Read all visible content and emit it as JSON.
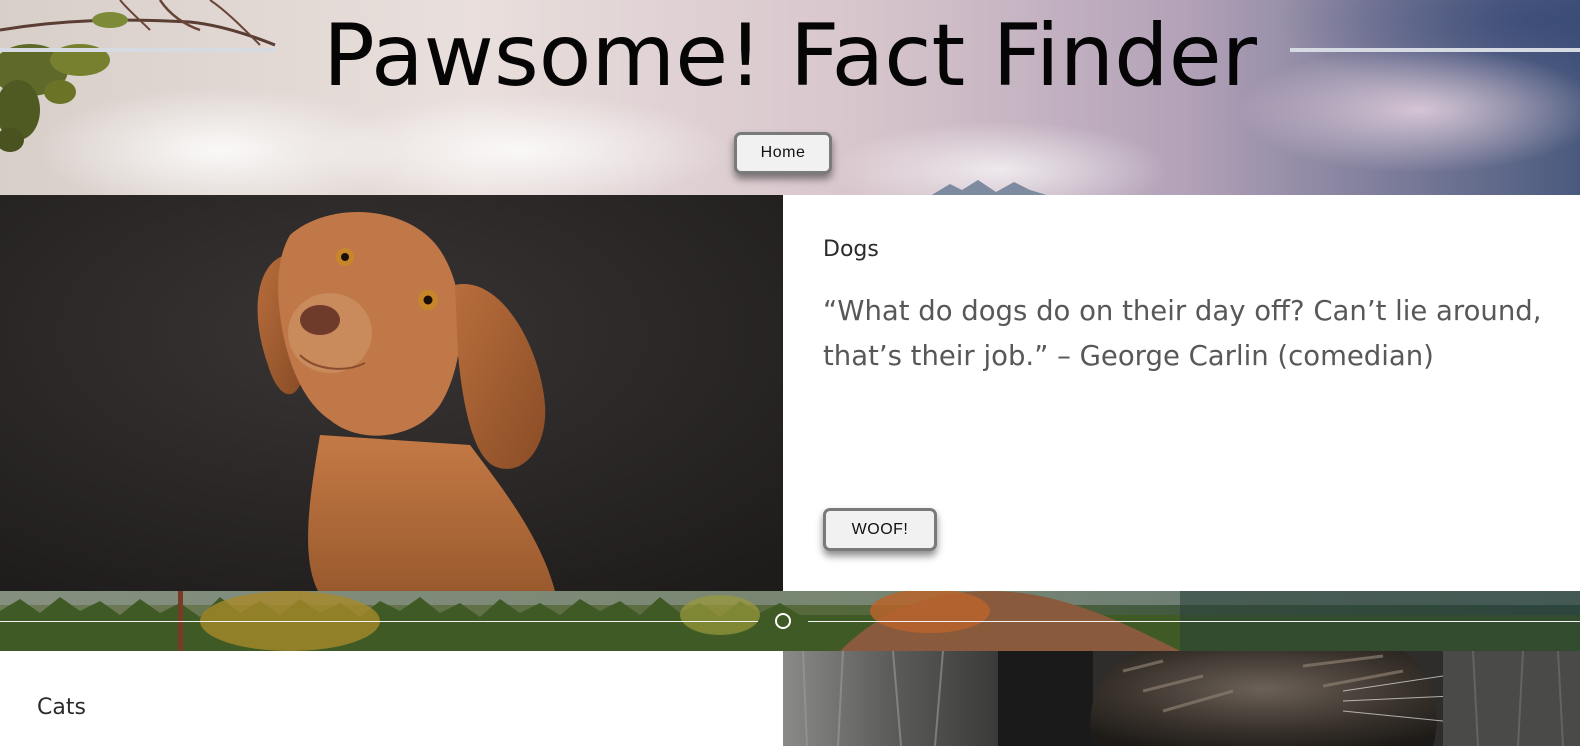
{
  "header": {
    "title": "Pawsome! Fact Finder",
    "nav": {
      "home_label": "Home"
    }
  },
  "sections": {
    "dogs": {
      "label": "Dogs",
      "quote": "“What do dogs do on their day off? Can’t lie around, that’s their job.” – George Carlin (comedian)",
      "button_label": "WOOF!"
    },
    "cats": {
      "label": "Cats"
    }
  },
  "colors": {
    "title_text": "#050505",
    "quote_text": "#585858",
    "button_bg": "#f1f1f1",
    "button_border": "#7a7a7a",
    "dog_photo_bg": "#2a2727"
  }
}
